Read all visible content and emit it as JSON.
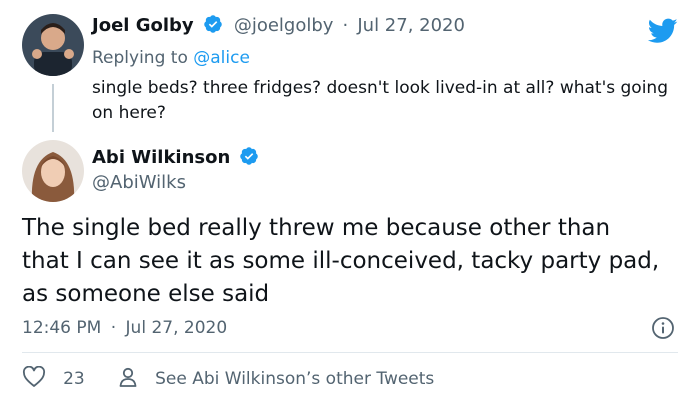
{
  "reply_tweet": {
    "author_name": "Joel Golby",
    "handle": "@joelgolby",
    "separator": "·",
    "date": "Jul 27, 2020",
    "replying_to_prefix": "Replying to ",
    "replying_to_handle": "@alice",
    "text": "single beds? three fridges? doesn't look lived-in at all? what's going on here?",
    "verified": true
  },
  "main_tweet": {
    "author_name": "Abi Wilkinson",
    "handle": "@AbiWilks",
    "verified": true,
    "text": "The single bed really threw me because other than that I can see it as some ill-conceived, tacky party pad, as someone else said",
    "time": "12:46 PM",
    "separator": "·",
    "date": "Jul 27, 2020",
    "like_count": "23",
    "other_tweets_label": "See Abi Wilkinson’s other Tweets"
  },
  "icons": {
    "brand": "twitter-bird-icon",
    "verified": "verified-badge-icon",
    "info": "info-icon",
    "like": "heart-icon",
    "profile": "person-icon"
  },
  "colors": {
    "brand_blue": "#1d9bf0",
    "text": "#0f1419",
    "secondary": "#536471"
  }
}
